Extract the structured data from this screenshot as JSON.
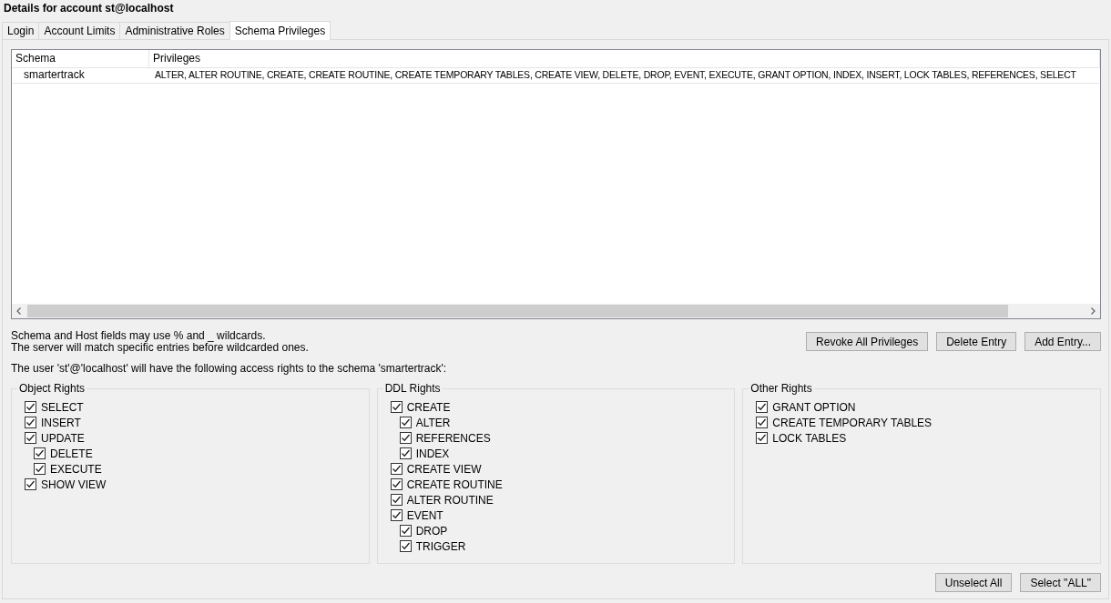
{
  "window": {
    "title": "Details for account st@localhost"
  },
  "tabs": [
    {
      "label": "Login",
      "selected": false
    },
    {
      "label": "Account Limits",
      "selected": false
    },
    {
      "label": "Administrative Roles",
      "selected": false
    },
    {
      "label": "Schema Privileges",
      "selected": true
    }
  ],
  "schema_table": {
    "columns": [
      "Schema",
      "Privileges"
    ],
    "rows": [
      {
        "cells": [
          "smartertrack",
          "ALTER, ALTER ROUTINE, CREATE, CREATE ROUTINE, CREATE TEMPORARY TABLES, CREATE VIEW, DELETE, DROP, EVENT, EXECUTE, GRANT OPTION, INDEX, INSERT, LOCK TABLES, REFERENCES, SELECT"
        ]
      }
    ]
  },
  "notes": [
    "Schema and Host fields may use % and _ wildcards.",
    "The server will match specific entries before wildcarded ones."
  ],
  "entry_buttons": [
    "Revoke All Privileges",
    "Delete Entry",
    "Add Entry..."
  ],
  "access_note": "The user 'st'@'localhost' will have the following access rights to the schema 'smartertrack':",
  "groups": [
    {
      "title": "Object Rights",
      "items": [
        {
          "label": "SELECT",
          "checked": true
        },
        {
          "label": "INSERT",
          "checked": true
        },
        {
          "label": "UPDATE",
          "checked": true,
          "children": [
            {
              "label": "DELETE",
              "checked": true
            },
            {
              "label": "EXECUTE",
              "checked": true
            }
          ]
        },
        {
          "label": "SHOW VIEW",
          "checked": true
        }
      ]
    },
    {
      "title": "DDL Rights",
      "items": [
        {
          "label": "CREATE",
          "checked": true,
          "children": [
            {
              "label": "ALTER",
              "checked": true
            },
            {
              "label": "REFERENCES",
              "checked": true
            },
            {
              "label": "INDEX",
              "checked": true
            }
          ]
        },
        {
          "label": "CREATE VIEW",
          "checked": true
        },
        {
          "label": "CREATE ROUTINE",
          "checked": true
        },
        {
          "label": "ALTER ROUTINE",
          "checked": true
        },
        {
          "label": "EVENT",
          "checked": true,
          "children": [
            {
              "label": "DROP",
              "checked": true
            },
            {
              "label": "TRIGGER",
              "checked": true
            }
          ]
        }
      ]
    },
    {
      "title": "Other Rights",
      "items": [
        {
          "label": "GRANT OPTION",
          "checked": true
        },
        {
          "label": "CREATE TEMPORARY TABLES",
          "checked": true
        },
        {
          "label": "LOCK TABLES",
          "checked": true
        }
      ]
    }
  ],
  "bottom_buttons": [
    "Unselect All",
    "Select \"ALL\""
  ]
}
